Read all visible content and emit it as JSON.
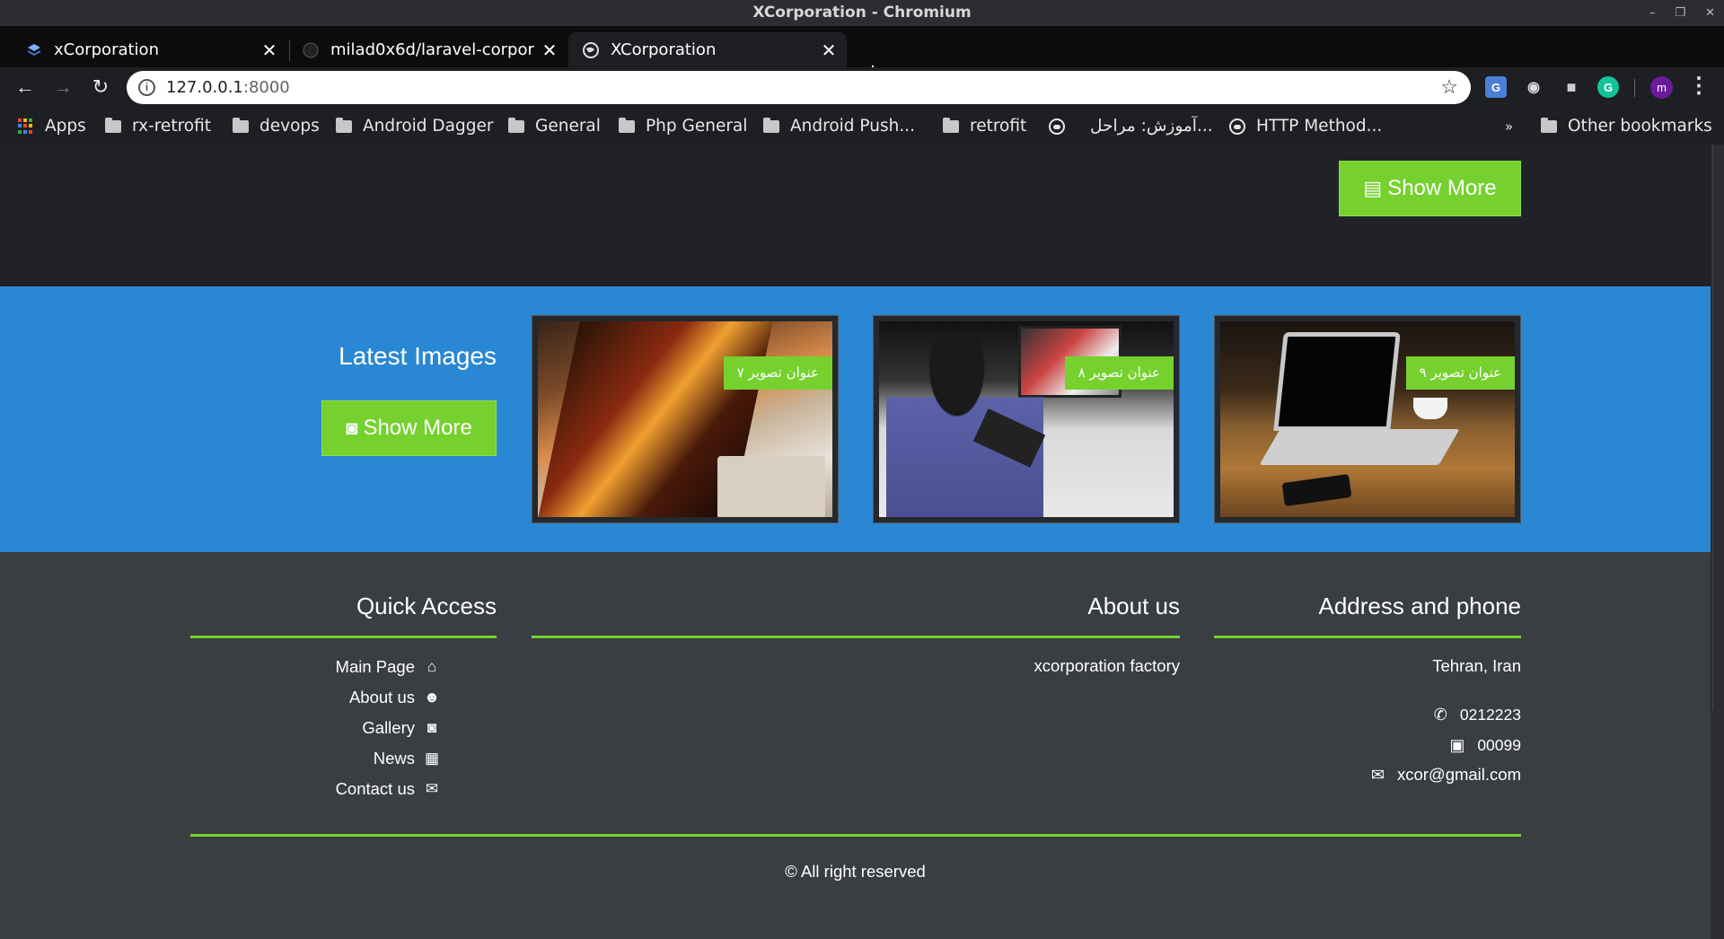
{
  "window": {
    "title": "XCorporation - Chromium",
    "controls": [
      "–",
      "❐",
      "✕"
    ]
  },
  "tabs": [
    {
      "label": "xCorporation",
      "active": false
    },
    {
      "label": "milad0x6d/laravel-corpor",
      "active": false
    },
    {
      "label": "XCorporation",
      "active": true
    }
  ],
  "new_tab_label": "+",
  "toolbar": {
    "url_host": "127.0.0.1",
    "url_port": ":8000",
    "profile_initial": "m"
  },
  "bookmarks": {
    "items": [
      "Apps",
      "rx-retrofit",
      "devops",
      "Android Dagger",
      "General",
      "Php General",
      "Android Push...",
      "retrofit",
      "آموزش: مراحل...",
      "HTTP Method..."
    ],
    "overflow": "»",
    "other": "Other bookmarks"
  },
  "news_section": {
    "show_more": "Show More"
  },
  "images_section": {
    "title": "Latest Images",
    "show_more": "Show More",
    "images": [
      {
        "caption": "عنوان تصویر ۷"
      },
      {
        "caption": "عنوان تصویر ۸"
      },
      {
        "caption": "عنوان تصویر ۹"
      }
    ]
  },
  "footer": {
    "quick_access": {
      "title": "Quick Access",
      "links": [
        {
          "label": "Main Page",
          "icon": "home-icon"
        },
        {
          "label": "About us",
          "icon": "users-icon"
        },
        {
          "label": "Gallery",
          "icon": "camera-icon"
        },
        {
          "label": "News",
          "icon": "calendar-icon"
        },
        {
          "label": "Contact us",
          "icon": "envelope-icon"
        }
      ]
    },
    "about": {
      "title": "About us",
      "text": "xcorporation factory"
    },
    "address": {
      "title": "Address and phone",
      "location": "Tehran, Iran",
      "phone": "0212223",
      "fax": "00099",
      "email": "xcor@gmail.com"
    },
    "copyright": "© All right reserved"
  },
  "colors": {
    "accent_green": "#76d12f",
    "section_blue": "#2a87d3",
    "footer_bg": "#3a3d42",
    "dark_bg": "#202226"
  }
}
